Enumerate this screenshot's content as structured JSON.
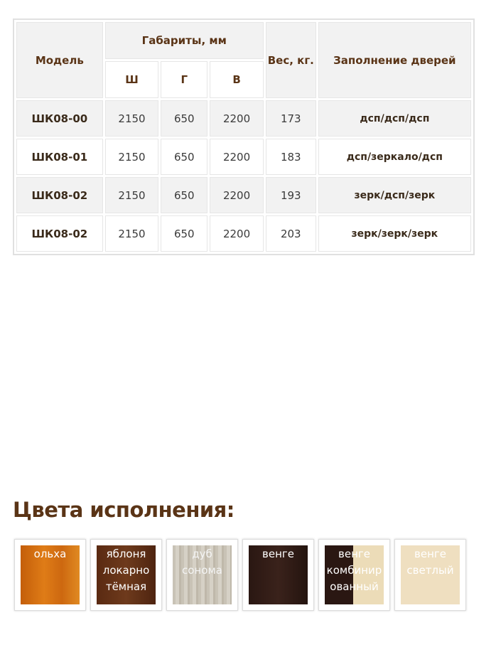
{
  "table": {
    "head": {
      "model": "Модель",
      "dims": "Габариты, мм",
      "weight": "Вес, кг.",
      "fill": "Заполнение дверей",
      "w": "Ш",
      "d": "Г",
      "h": "В"
    },
    "rows": [
      {
        "model": "ШК08-00",
        "w": "2150",
        "d": "650",
        "h": "2200",
        "weight": "173",
        "fill": "дсп/дсп/дсп"
      },
      {
        "model": "ШК08-01",
        "w": "2150",
        "d": "650",
        "h": "2200",
        "weight": "183",
        "fill": "дсп/зеркало/дсп"
      },
      {
        "model": "ШК08-02",
        "w": "2150",
        "d": "650",
        "h": "2200",
        "weight": "193",
        "fill": "зерк/дсп/зерк"
      },
      {
        "model": "ШК08-02",
        "w": "2150",
        "d": "650",
        "h": "2200",
        "weight": "203",
        "fill": "зерк/зерк/зерк"
      }
    ]
  },
  "colors": {
    "title": "Цвета исполнения:",
    "items": [
      {
        "label": "ольха"
      },
      {
        "label": "яблоня локарно тёмная"
      },
      {
        "label": "дуб сонома"
      },
      {
        "label": "венге"
      },
      {
        "label": "венге комбинированный"
      },
      {
        "label": "венге светлый"
      }
    ],
    "accent": "#5a3416"
  }
}
